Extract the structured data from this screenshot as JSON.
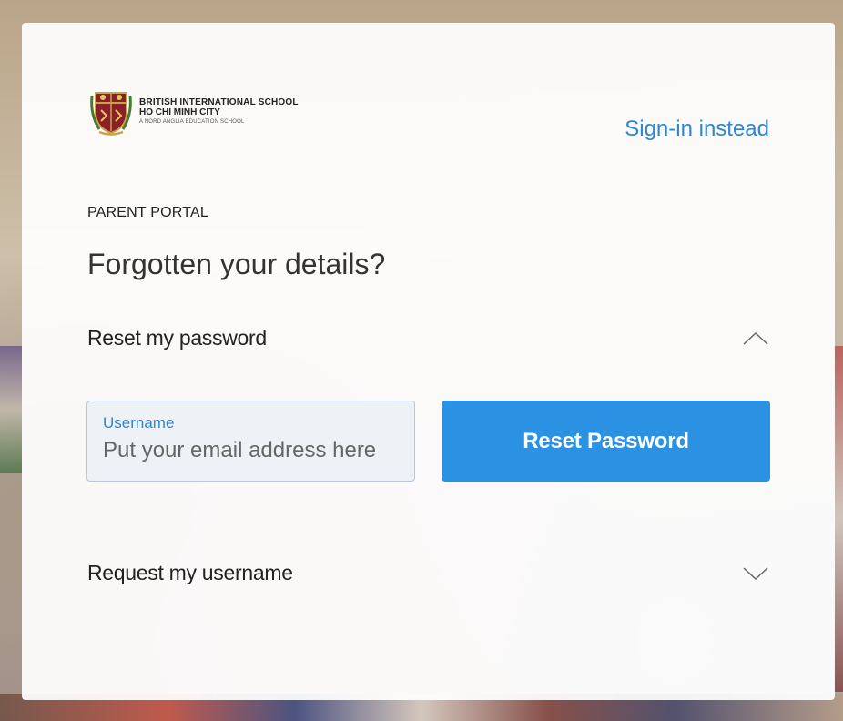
{
  "school": {
    "name_line1": "BRITISH INTERNATIONAL SCHOOL",
    "name_line2": "HO CHI MINH CITY",
    "tagline": "A NORD ANGLIA EDUCATION SCHOOL"
  },
  "header": {
    "signin_link": "Sign-in instead"
  },
  "portal_label": "PARENT PORTAL",
  "page_title": "Forgotten your details?",
  "reset_section": {
    "title": "Reset my password",
    "expanded": true,
    "input_label": "Username",
    "input_placeholder": "Put your email address here",
    "button_label": "Reset Password"
  },
  "request_section": {
    "title": "Request my username",
    "expanded": false
  },
  "colors": {
    "accent": "#2b86d4",
    "button": "#2b92e3"
  },
  "icons": {
    "crest": "school-crest-icon",
    "chevron_up": "chevron-up-icon",
    "chevron_down": "chevron-down-icon"
  }
}
